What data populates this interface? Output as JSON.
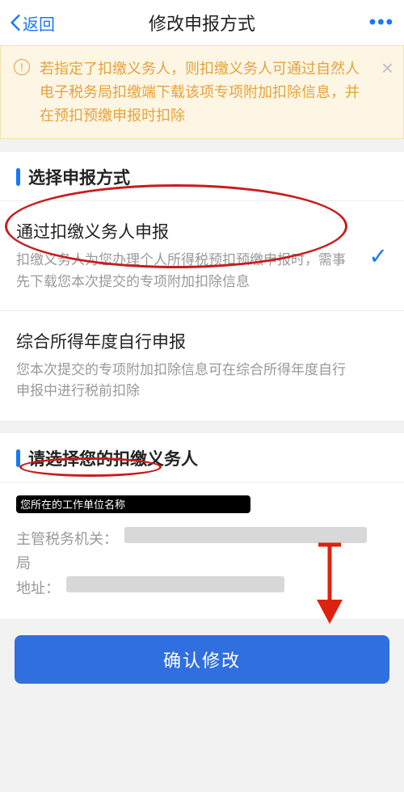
{
  "header": {
    "back_label": "返回",
    "title": "修改申报方式",
    "more_label": "•••"
  },
  "notice": {
    "text": "若指定了扣缴义务人，则扣缴义务人可通过自然人电子税务局扣缴端下载该项专项附加扣除信息，并在预扣预缴申报时扣除"
  },
  "section_method": {
    "title": "选择申报方式",
    "options": [
      {
        "title": "通过扣缴义务人申报",
        "desc": "扣缴义务人为您办理个人所得税预扣预缴申报时，需事先下载您本次提交的专项附加扣除信息",
        "selected": true
      },
      {
        "title": "综合所得年度自行申报",
        "desc": "您本次提交的专项附加扣除信息可在综合所得年度自行申报中进行税前扣除",
        "selected": false
      }
    ]
  },
  "section_employer": {
    "title": "请选择您的扣缴义务人",
    "name_label": "您所在的工作单位名称",
    "authority_label": "主管税务机关：",
    "authority_value_suffix": "局",
    "address_label": "地址："
  },
  "confirm_label": "确认修改"
}
